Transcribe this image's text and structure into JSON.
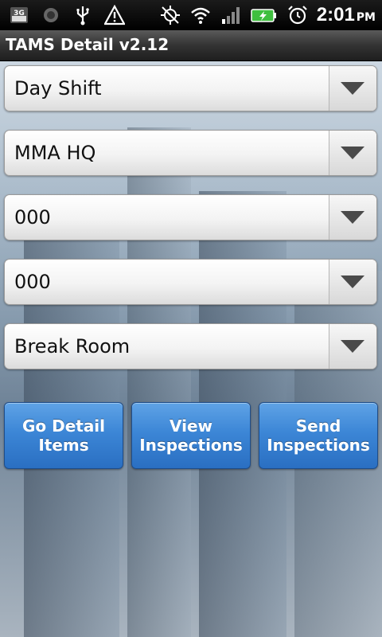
{
  "status_bar": {
    "time": "2:01",
    "ampm": "PM",
    "icons": [
      "3g-icon",
      "sync-icon",
      "usb-icon",
      "warning-icon",
      "gps-off-icon",
      "wifi-icon",
      "signal-icon",
      "battery-charging-icon",
      "alarm-icon"
    ],
    "network_label": "3G"
  },
  "app": {
    "title": "TAMS Detail v2.12"
  },
  "spinners": [
    {
      "name": "shift",
      "value": "Day Shift"
    },
    {
      "name": "location",
      "value": "MMA HQ"
    },
    {
      "name": "building",
      "value": "000"
    },
    {
      "name": "floor",
      "value": "000"
    },
    {
      "name": "room",
      "value": "Break Room"
    }
  ],
  "buttons": {
    "go_detail_items": "Go Detail Items",
    "view_inspections": "View Inspections",
    "send_inspections": "Send Inspections"
  },
  "colors": {
    "button_blue": "#3c86d6",
    "titlebar": "#333333"
  }
}
